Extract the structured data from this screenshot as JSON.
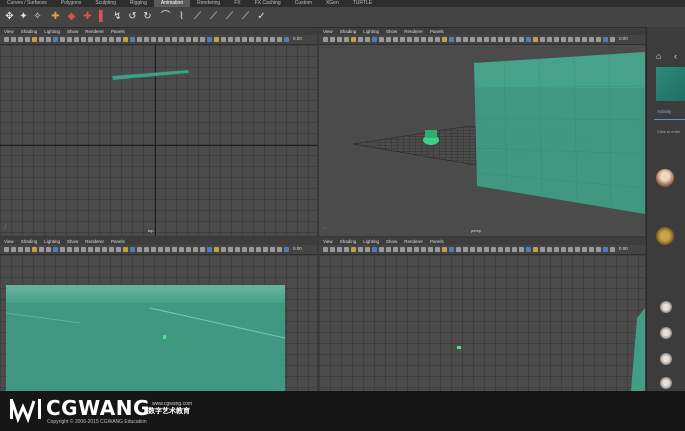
{
  "shelf_tabs": [
    "Curves / Surfaces",
    "Polygons",
    "Sculpting",
    "Rigging",
    "Animation",
    "Rendering",
    "FX",
    "FX Caching",
    "Custom",
    "XGen",
    "TURTLE"
  ],
  "shelf_active_index": 4,
  "shelf_icons": [
    "select-tool-icon",
    "lasso-tool-icon",
    "paint-select-icon",
    "move-tool-icon",
    "key-icon",
    "set-key-icon",
    "breakdown-icon",
    "ik-handle-icon",
    "joint-icon",
    "skin-icon",
    "curve-icon",
    "constraint-icon",
    "motion-path-icon",
    "ghost-icon",
    "playblast-icon",
    "camera-icon",
    "anim-layer-icon"
  ],
  "panel_menu": [
    "View",
    "Shading",
    "Lighting",
    "Show",
    "Renderer",
    "Panels"
  ],
  "toolbar_value": "0.00",
  "viewports": [
    {
      "name": "viewport-top-left",
      "camera_label": "top"
    },
    {
      "name": "viewport-top-right",
      "camera_label": "persp"
    },
    {
      "name": "viewport-bottom-left",
      "camera_label": ""
    },
    {
      "name": "viewport-bottom-right",
      "camera_label": ""
    }
  ],
  "right_panel": {
    "tab_label": "Activity",
    "hint": "Click to enter"
  },
  "footer": {
    "brand": "CGWANG",
    "url": "www.cgwang.com",
    "tagline_cn": "数字艺术教育",
    "copyright": "Copyright © 2006-2015 CGWANG Education"
  },
  "colors": {
    "plane_teal": "#3f9e84",
    "pane_bg": "#4b4b4b",
    "footer_bg": "#161616"
  }
}
